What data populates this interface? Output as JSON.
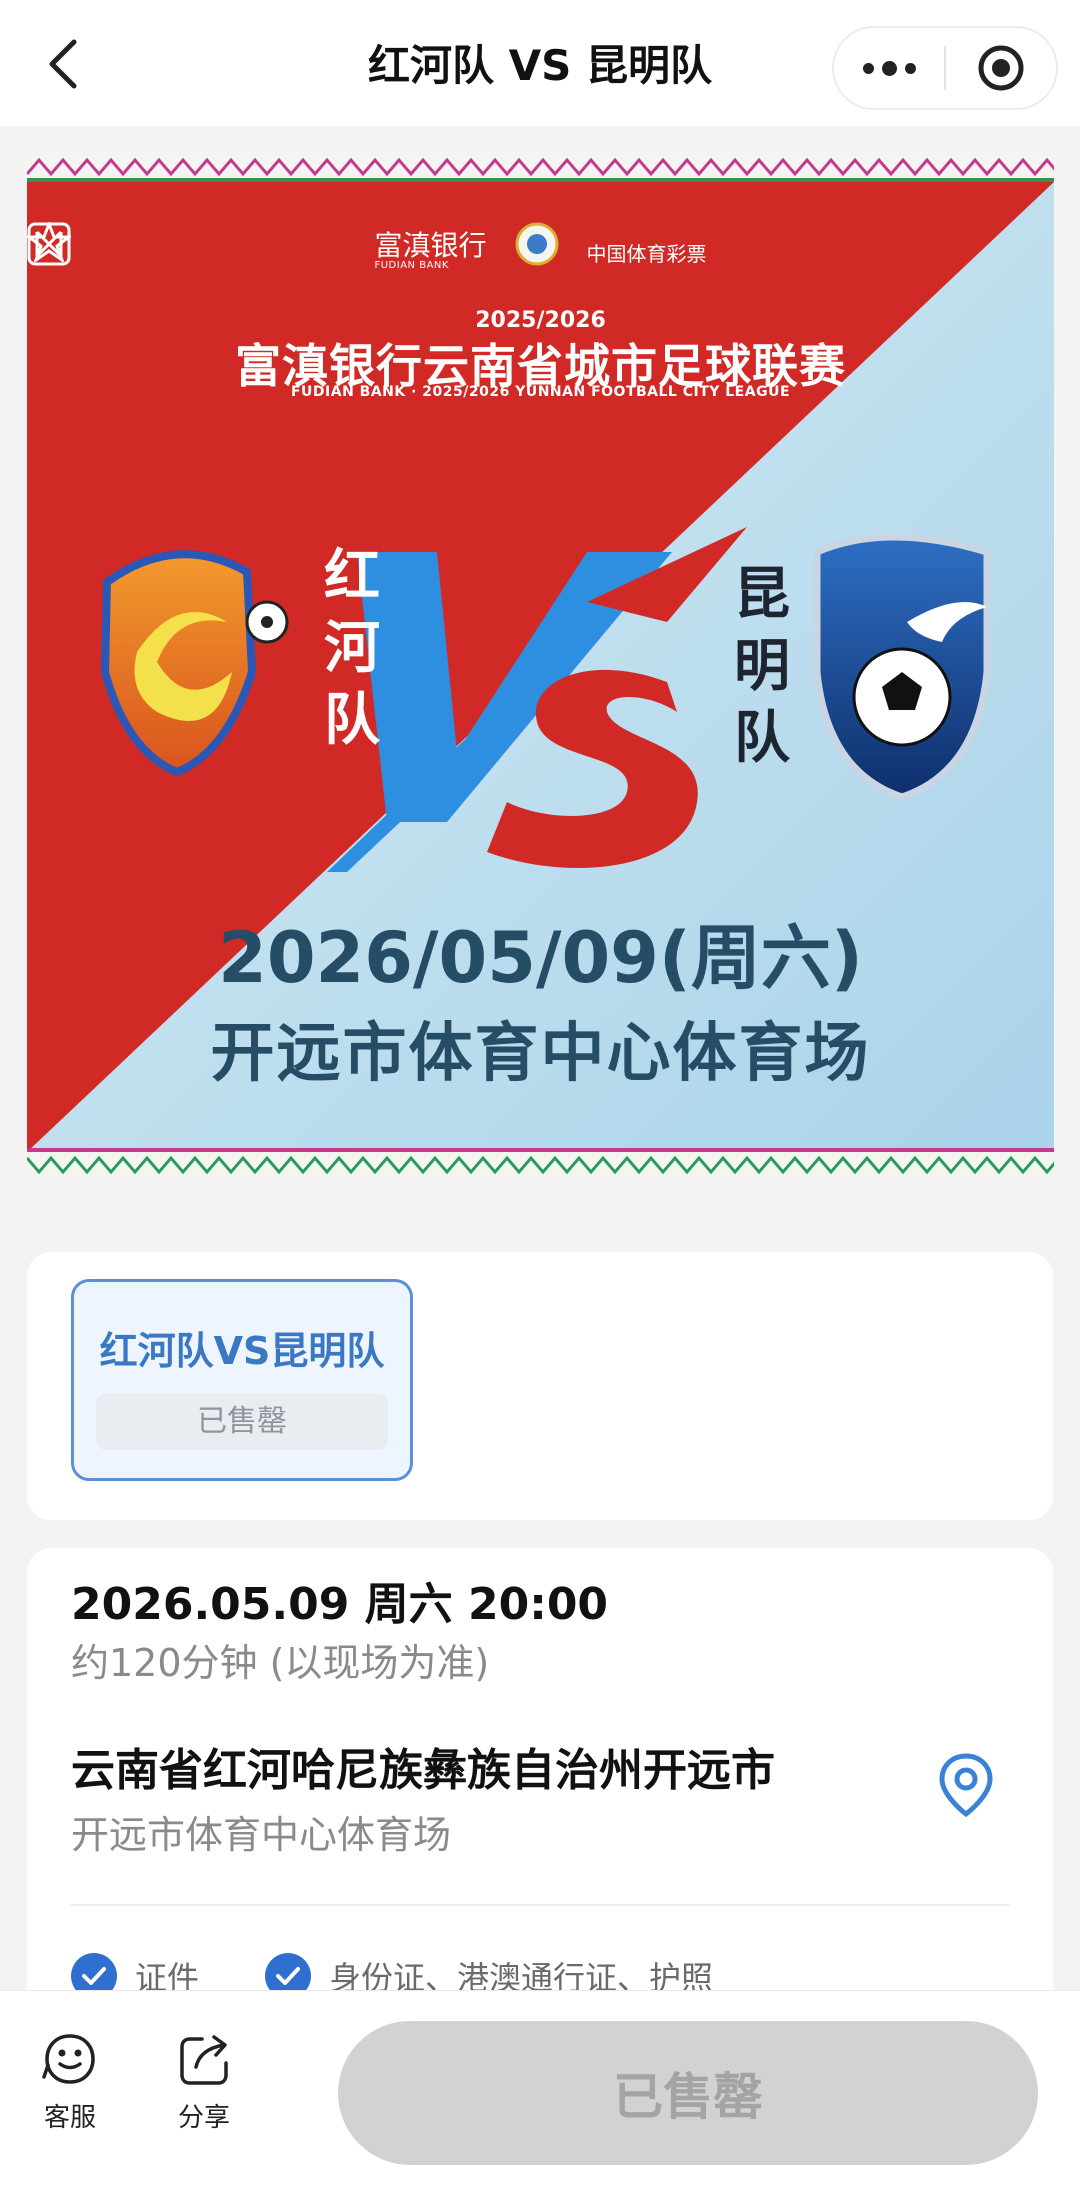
{
  "header": {
    "title": "红河队 VS 昆明队"
  },
  "poster": {
    "sponsor_bank": "富滇银行",
    "sponsor_bank_en": "FUDIAN BANK",
    "sponsor_lottery": "中国体育彩票",
    "league_year": "2025/2026",
    "league_name": "富滇银行云南省城市足球联赛",
    "league_name_en": "FUDIAN BANK · 2025/2026 YUNNAN FOOTBALL CITY  LEAGUE",
    "home_team": "红河队",
    "away_team": "昆明队",
    "vs": "VS",
    "match_date": "2026/05/09(周六)",
    "venue": "开远市体育中心体育场",
    "colors": {
      "red": "#d12a26",
      "light_blue": "#bfe0ef",
      "vs_blue": "#2e8ee0"
    }
  },
  "session": {
    "name": "红河队VS昆明队",
    "status": "已售罄"
  },
  "info": {
    "datetime": "2026.05.09 周六 20:00",
    "duration": "约120分钟 (以现场为准)",
    "address": "云南省红河哈尼族彝族自治州开远市",
    "venue": "开远市体育中心体育场",
    "docs_label": "证件",
    "docs_value": "身份证、港澳通行证、护照"
  },
  "bottom": {
    "service_label": "客服",
    "share_label": "分享",
    "buy_label": "已售罄"
  },
  "icons": {
    "back": "chevron-left-icon",
    "more": "more-dots-icon",
    "close": "target-icon",
    "location": "location-pin-icon",
    "check": "check-circle-icon",
    "service": "smiley-chat-icon",
    "share": "share-icon"
  }
}
